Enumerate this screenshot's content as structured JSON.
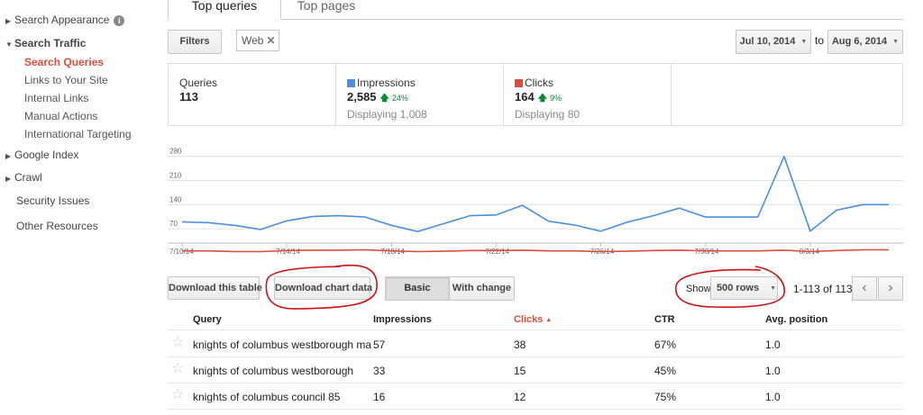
{
  "sidebar": {
    "items": [
      {
        "label": "Search Appearance",
        "expandable": true,
        "expanded": false
      },
      {
        "label": "Search Traffic",
        "expandable": true,
        "expanded": true
      },
      {
        "label": "Google Index",
        "expandable": true,
        "expanded": false
      },
      {
        "label": "Crawl",
        "expandable": true,
        "expanded": false
      },
      {
        "label": "Security Issues",
        "expandable": false
      },
      {
        "label": "Other Resources",
        "expandable": false
      }
    ],
    "search_traffic_children": [
      {
        "label": "Search Queries",
        "active": true
      },
      {
        "label": "Links to Your Site",
        "active": false
      },
      {
        "label": "Internal Links",
        "active": false
      },
      {
        "label": "Manual Actions",
        "active": false
      },
      {
        "label": "International Targeting",
        "active": false
      }
    ],
    "info_icon": "i"
  },
  "tabs": [
    {
      "label": "Top queries",
      "active": true
    },
    {
      "label": "Top pages",
      "active": false
    }
  ],
  "filters": {
    "button_label": "Filters",
    "chip_label": "Web",
    "chip_remove": "✕"
  },
  "date_range": {
    "start": "Jul 10, 2014",
    "to_label": "to",
    "end": "Aug 6, 2014"
  },
  "stats": {
    "queries": {
      "label": "Queries",
      "value": "113"
    },
    "impressions": {
      "label": "Impressions",
      "value": "2,585",
      "change": "24%",
      "sub": "Displaying 1,008",
      "color": "#4a90e2"
    },
    "clicks": {
      "label": "Clicks",
      "value": "164",
      "change": "9%",
      "sub": "Displaying 80",
      "color": "#dd4b39"
    }
  },
  "chart_data": {
    "type": "line",
    "y_ticks": [
      "280",
      "210",
      "140",
      "70"
    ],
    "ylim": [
      0,
      300
    ],
    "x_tick_labels": [
      "7/10/14",
      "7/14/14",
      "7/18/14",
      "7/22/14",
      "7/26/14",
      "7/30/14",
      "8/3/14"
    ],
    "x": [
      "7/10/14",
      "7/11/14",
      "7/12/14",
      "7/13/14",
      "7/14/14",
      "7/15/14",
      "7/16/14",
      "7/17/14",
      "7/18/14",
      "7/19/14",
      "7/20/14",
      "7/21/14",
      "7/22/14",
      "7/23/14",
      "7/24/14",
      "7/25/14",
      "7/26/14",
      "7/27/14",
      "7/28/14",
      "7/29/14",
      "7/30/14",
      "7/31/14",
      "8/1/14",
      "8/2/14",
      "8/3/14",
      "8/4/14",
      "8/5/14",
      "8/6/14"
    ],
    "series": [
      {
        "name": "Impressions",
        "color": "#4a90e2",
        "values": [
          90,
          88,
          80,
          68,
          93,
          106,
          108,
          104,
          80,
          62,
          85,
          108,
          110,
          138,
          92,
          81,
          63,
          89,
          108,
          130,
          104,
          104,
          104,
          280,
          63,
          124,
          140,
          140
        ]
      },
      {
        "name": "Clicks",
        "color": "#dd4b39",
        "values": [
          6,
          6,
          4,
          4,
          7,
          8,
          8,
          9,
          6,
          4,
          5,
          7,
          7,
          8,
          6,
          6,
          4,
          5,
          7,
          8,
          6,
          6,
          6,
          8,
          4,
          7,
          9,
          9
        ]
      }
    ],
    "grid": true
  },
  "controls": {
    "download_table": "Download this table",
    "download_chart": "Download chart data",
    "view_basic": "Basic",
    "view_change": "With change",
    "show_label": "Show",
    "rows_value": "500 rows",
    "pager_text": "1-113 of 113",
    "prev": "‹",
    "next": "›"
  },
  "table": {
    "columns": [
      "Query",
      "Impressions",
      "Clicks",
      "CTR",
      "Avg. position"
    ],
    "sorted_column": "Clicks",
    "rows": [
      {
        "query": "knights of columbus westborough ma",
        "impressions": "57",
        "clicks": "38",
        "ctr": "67%",
        "position": "1.0"
      },
      {
        "query": "knights of columbus westborough",
        "impressions": "33",
        "clicks": "15",
        "ctr": "45%",
        "position": "1.0"
      },
      {
        "query": "knights of columbus council 85",
        "impressions": "16",
        "clicks": "12",
        "ctr": "75%",
        "position": "1.0"
      }
    ]
  },
  "colors": {
    "accent_red": "#dd4b39",
    "impressions_blue": "#4a90e2",
    "annotation_red": "#d01010"
  }
}
